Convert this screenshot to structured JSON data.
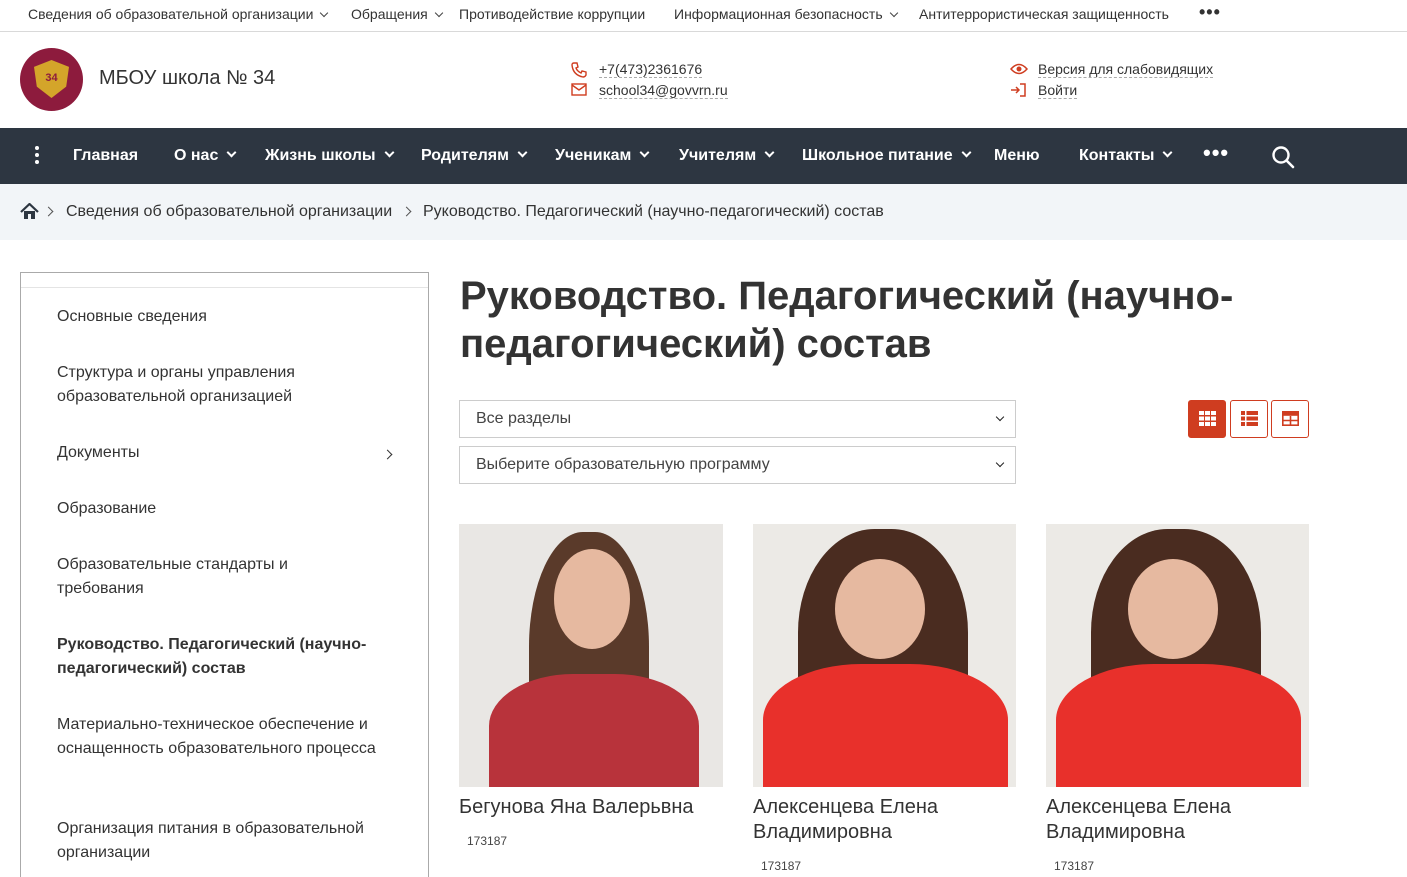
{
  "topbar": {
    "items": [
      {
        "label": "Сведения об образовательной организации",
        "dropdown": true
      },
      {
        "label": "Обращения",
        "dropdown": true
      },
      {
        "label": "Противодействие коррупции",
        "dropdown": false
      },
      {
        "label": "Информационная безопасность",
        "dropdown": true
      },
      {
        "label": "Антитеррористическая защищенность",
        "dropdown": false
      }
    ],
    "more": "•••"
  },
  "header": {
    "logo_text": "34",
    "site_name": "МБОУ школа № 34",
    "phone": "+7(473)2361676",
    "email": "school34@govvrn.ru",
    "accessibility": "Версия для слабовидящих",
    "login": "Войти",
    "accent_color": "#cf3d20"
  },
  "nav": {
    "items": [
      {
        "label": "Главная",
        "dropdown": false
      },
      {
        "label": "О нас",
        "dropdown": true
      },
      {
        "label": "Жизнь школы",
        "dropdown": true
      },
      {
        "label": "Родителям",
        "dropdown": true
      },
      {
        "label": "Ученикам",
        "dropdown": true
      },
      {
        "label": "Учителям",
        "dropdown": true
      },
      {
        "label": "Школьное питание",
        "dropdown": true
      },
      {
        "label": "Меню",
        "dropdown": false
      },
      {
        "label": "Контакты",
        "dropdown": true
      }
    ],
    "more": "•••",
    "background": "#2d3641"
  },
  "breadcrumb": {
    "items": [
      "Сведения об образовательной организации",
      "Руководство. Педагогический (научно-педагогический) состав"
    ]
  },
  "sidebar": {
    "items": [
      {
        "label": "Основные сведения",
        "active": false
      },
      {
        "label": "Структура и органы управления образовательной организацией",
        "active": false
      },
      {
        "label": "Документы",
        "active": false,
        "has_children": true
      },
      {
        "label": "Образование",
        "active": false
      },
      {
        "label": "Образовательные стандарты и требования",
        "active": false
      },
      {
        "label": "Руководство. Педагогический (научно-педагогический) состав",
        "active": true
      },
      {
        "label": "Материально-техническое обеспечение и оснащенность образовательного процесса",
        "active": false
      },
      {
        "label": "Организация питания в образовательной организации",
        "active": false
      }
    ]
  },
  "main": {
    "title": "Руководство. Педагогический (научно-педагогический) состав",
    "filter_section": "Все разделы",
    "filter_program": "Выберите образовательную программу",
    "view_modes": [
      "grid-view",
      "list-view",
      "table-view"
    ],
    "active_view": "grid-view",
    "cards": [
      {
        "name": "Бегунова Яна Валерьвна",
        "number": "173187"
      },
      {
        "name": "Алексенцева Елена Владимировна",
        "number": "173187"
      },
      {
        "name": "Алексенцева Елена Владимировна",
        "number": "173187"
      }
    ]
  }
}
